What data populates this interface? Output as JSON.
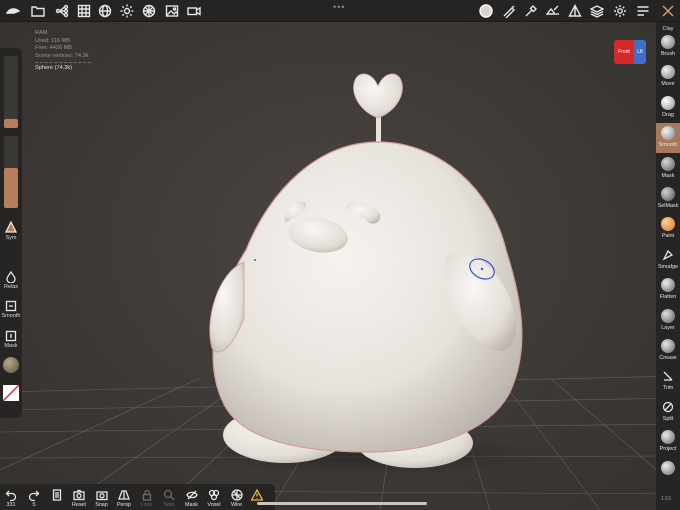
{
  "app": {
    "accent": "#a8785a"
  },
  "topbar": {
    "icons": [
      "scene-menu-icon",
      "files-icon",
      "scene-tree-icon",
      "grid-settings-icon",
      "display-icon",
      "light-icon",
      "material-icon",
      "background-icon",
      "video-icon",
      "matcap-icon",
      "brush-stroke-icon",
      "picker-icon",
      "tools-settings-icon",
      "topology-icon",
      "layers-icon",
      "settings-icon",
      "sculpt-menu-icon",
      "toggle-interface-icon"
    ]
  },
  "stats": {
    "ram": "RAM",
    "used": "Used: 116 MB",
    "free": "Free: 4426 MB",
    "vertices": "Scene vertices: 74.3k",
    "mesh": "Sphere (74.3k)"
  },
  "left_panel": {
    "radius_value": 0.12,
    "intensity_value": 0.55,
    "sym_label": "Sym",
    "relax_label": "Relax",
    "smooth_label": "Smooth",
    "mask_label": "Mask"
  },
  "view_cube": {
    "front_label": "Front",
    "left_label": "Lft"
  },
  "right_panel": {
    "clay_label": "Clay",
    "tools": [
      {
        "label": "Brush",
        "active": false
      },
      {
        "label": "Move",
        "active": false
      },
      {
        "label": "Drag",
        "active": false
      },
      {
        "label": "Smooth",
        "active": true
      },
      {
        "label": "Mask",
        "active": false
      },
      {
        "label": "SelMask",
        "active": false
      },
      {
        "label": "Paint",
        "active": false
      },
      {
        "label": "Smudge",
        "active": false
      },
      {
        "label": "Flatten",
        "active": false
      },
      {
        "label": "Layer",
        "active": false
      },
      {
        "label": "Crease",
        "active": false
      },
      {
        "label": "Trim",
        "active": false
      },
      {
        "label": "Split",
        "active": false
      },
      {
        "label": "Project",
        "active": false
      }
    ]
  },
  "bottom_bar": {
    "undo_count": "331",
    "redo_count": "5",
    "items": [
      {
        "label": "Reset",
        "enabled": true
      },
      {
        "label": "Snap",
        "enabled": true
      },
      {
        "label": "Persp",
        "enabled": true
      },
      {
        "label": "Lock",
        "enabled": false
      },
      {
        "label": "Solo",
        "enabled": false
      },
      {
        "label": "Mask",
        "enabled": true
      },
      {
        "label": "Voxel",
        "enabled": true
      },
      {
        "label": "Wire",
        "enabled": true
      }
    ]
  },
  "version": "1.63"
}
